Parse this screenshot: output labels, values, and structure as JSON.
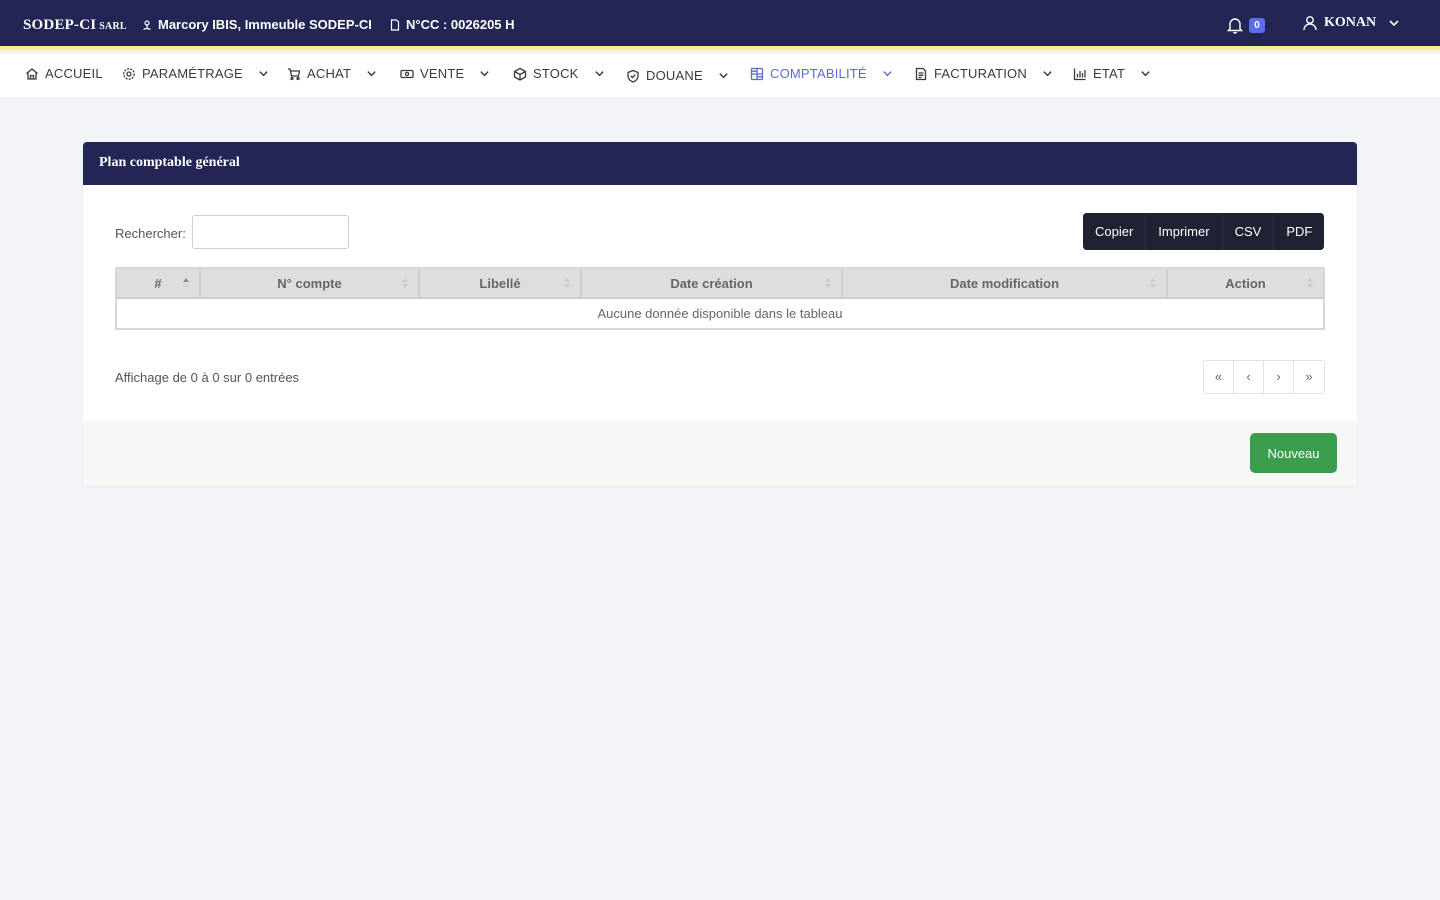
{
  "header": {
    "brand": "SODEP-CI",
    "brand_suffix": "SARL",
    "address": "Marcory IBIS, Immeuble SODEP-CI",
    "ncc": "N°CC : 0026205 H",
    "notification_count": "0",
    "user_name": "KONAN"
  },
  "nav": {
    "items": [
      {
        "label": "ACCUEIL",
        "icon": "home-icon"
      },
      {
        "label": "PARAMÉTRAGE",
        "icon": "gear-icon"
      },
      {
        "label": "ACHAT",
        "icon": "cart-icon"
      },
      {
        "label": "VENTE",
        "icon": "cash-icon"
      },
      {
        "label": "STOCK",
        "icon": "box-icon"
      },
      {
        "label": "DOUANE",
        "icon": "shield-icon"
      },
      {
        "label": "COMPTABILITÉ",
        "icon": "grid-icon",
        "active": true
      },
      {
        "label": "FACTURATION",
        "icon": "invoice-icon"
      },
      {
        "label": "ETAT",
        "icon": "bar-chart-icon"
      }
    ]
  },
  "card": {
    "title": "Plan comptable général",
    "search_label": "Rechercher:",
    "search_value": "",
    "export_buttons": [
      "Copier",
      "Imprimer",
      "CSV",
      "PDF"
    ],
    "columns": [
      "#",
      "N° compte",
      "Libellé",
      "Date création",
      "Date modification",
      "Action"
    ],
    "empty_message": "Aucune donnée disponible dans le tableau",
    "info": "Affichage de 0 à 0 sur 0 entrées",
    "pager": [
      "«",
      "‹",
      "›",
      "»"
    ],
    "new_button": "Nouveau"
  },
  "colors": {
    "header_bg": "#232554",
    "header_accent": "#f2f08a",
    "active_nav": "#5b6ad6",
    "badge": "#5a6ee8",
    "export_btn": "#1f2233",
    "new_btn": "#3b9e4c"
  }
}
